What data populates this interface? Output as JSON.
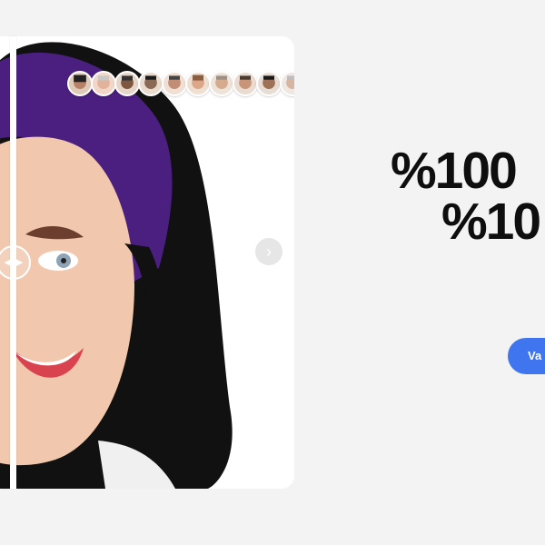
{
  "hero": {
    "headline_line1": "%100 ",
    "headline_line2": "%10",
    "cta_label": "Va"
  },
  "comparison": {
    "next_icon": "chevron-right-icon",
    "handle_icons": [
      "chevron-left-icon",
      "chevron-right-icon"
    ],
    "avatars": [
      {
        "name": "avatar-1"
      },
      {
        "name": "avatar-2"
      },
      {
        "name": "avatar-3"
      },
      {
        "name": "avatar-4"
      },
      {
        "name": "avatar-5"
      },
      {
        "name": "avatar-6"
      },
      {
        "name": "avatar-7"
      },
      {
        "name": "avatar-8"
      },
      {
        "name": "avatar-9"
      },
      {
        "name": "avatar-10"
      }
    ]
  },
  "colors": {
    "background": "#f2f3f2",
    "cta": "#3f76f0",
    "headline": "#0e0e0e"
  }
}
